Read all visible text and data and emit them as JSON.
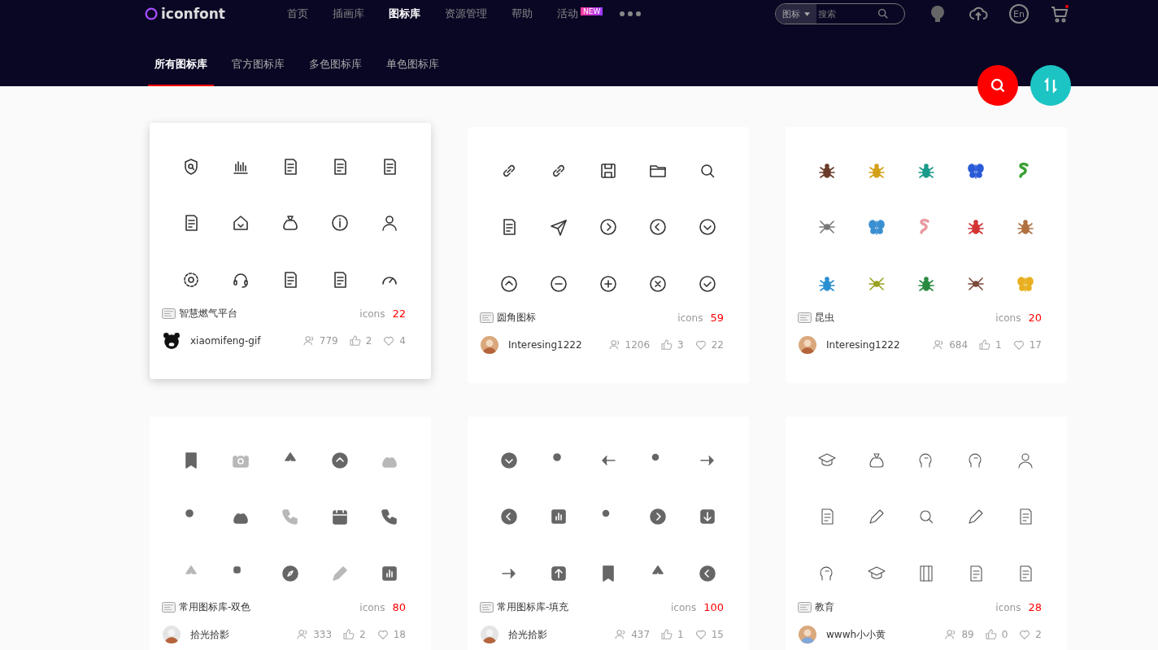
{
  "header": {
    "logo": "iconfont",
    "nav": [
      {
        "label": "首页",
        "selected": false
      },
      {
        "label": "插画库",
        "selected": false
      },
      {
        "label": "图标库",
        "selected": true
      },
      {
        "label": "资源管理",
        "selected": false
      },
      {
        "label": "帮助",
        "selected": false
      },
      {
        "label": "活动",
        "selected": false,
        "badge": "NEW"
      }
    ],
    "search": {
      "scope": "图标",
      "placeholder": "搜索"
    },
    "language": "En"
  },
  "tabs": [
    {
      "label": "所有图标库",
      "selected": true
    },
    {
      "label": "官方图标库",
      "selected": false
    },
    {
      "label": "多色图标库",
      "selected": false
    },
    {
      "label": "单色图标库",
      "selected": false
    }
  ],
  "libraries": [
    {
      "name": "智慧燃气平台",
      "count_label": "icons",
      "count": "22",
      "author": "xiaomifeng-gif",
      "views": "779",
      "likes": "2",
      "favorites": "4",
      "kind": "outline",
      "highlighted": true
    },
    {
      "name": "圆角图标",
      "count_label": "icons",
      "count": "59",
      "author": "Interesing1222",
      "views": "1206",
      "likes": "3",
      "favorites": "22",
      "kind": "outline",
      "highlighted": false
    },
    {
      "name": "昆虫",
      "count_label": "icons",
      "count": "20",
      "author": "Interesing1222",
      "views": "684",
      "likes": "1",
      "favorites": "17",
      "kind": "color",
      "highlighted": false
    },
    {
      "name": "常用图标库-双色",
      "count_label": "icons",
      "count": "80",
      "author": "拾光拾影",
      "views": "333",
      "likes": "2",
      "favorites": "18",
      "kind": "filled",
      "highlighted": false
    },
    {
      "name": "常用图标库-填充",
      "count_label": "icons",
      "count": "100",
      "author": "拾光拾影",
      "views": "437",
      "likes": "1",
      "favorites": "15",
      "kind": "filled",
      "highlighted": false
    },
    {
      "name": "教育",
      "count_label": "icons",
      "count": "28",
      "author": "wwwh小小黄",
      "views": "89",
      "likes": "0",
      "favorites": "2",
      "kind": "thin",
      "highlighted": false
    }
  ]
}
